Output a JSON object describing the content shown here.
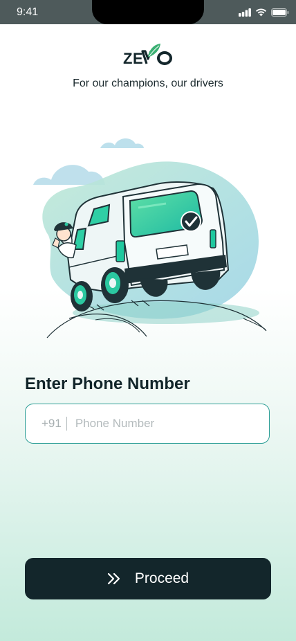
{
  "status_bar": {
    "time": "9:41",
    "icons": [
      "signal-icon",
      "wifi-icon",
      "battery-icon"
    ]
  },
  "brand": {
    "name": "ZEVO",
    "tagline": "For our champions, our drivers"
  },
  "illustration": {
    "subject": "driver-van-illustration"
  },
  "form": {
    "title": "Enter Phone Number",
    "country_code": "+91",
    "phone_placeholder": "Phone Number",
    "phone_value": ""
  },
  "actions": {
    "proceed_label": "Proceed",
    "proceed_icon": "double-chevron-right-icon"
  },
  "colors": {
    "accent": "#2e9f97",
    "button_bg": "#13262b",
    "logo_green": "#3bb073"
  }
}
